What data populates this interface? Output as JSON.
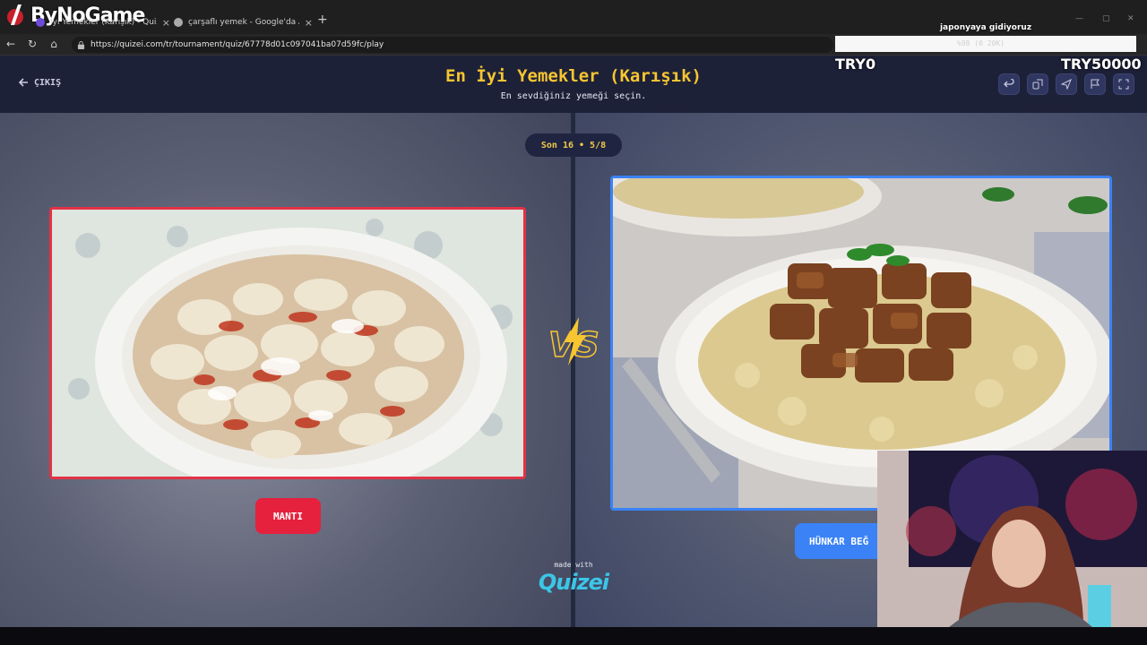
{
  "browser": {
    "brand": "ByNoGame",
    "tabs": [
      {
        "label": "İyi Yemekler (Karışık) - Quizei",
        "close": "×"
      },
      {
        "label": "çarşaflı yemek - Google'da Ara",
        "close": "×"
      }
    ],
    "new_tab": "+",
    "url": "https://quizei.com/tr/tournament/quiz/67778d01c097041ba07d59fc/play"
  },
  "stream_overlay": {
    "title": "japonyaya gidiyoruz",
    "progress_text": "%98 (0 20K)",
    "left_amount": "TRY0",
    "right_amount": "TRY50000"
  },
  "header": {
    "back_label": "ÇIKIŞ",
    "title": "En İyi Yemekler (Karışık)",
    "subtitle": "En sevdiğiniz yemeği seçin.",
    "actions": [
      "undo-icon",
      "share-link-icon",
      "send-icon",
      "flag-icon",
      "fullscreen-icon"
    ]
  },
  "round_badge": "Son 16 • 5/8",
  "left_choice": {
    "label": "MANTI",
    "accent": "#e5213d"
  },
  "right_choice": {
    "label": "HÜNKAR BEĞ",
    "accent": "#3b82f6"
  },
  "vs_text": "VS",
  "footer": {
    "made_with": "made with",
    "brand": "Quizei"
  }
}
